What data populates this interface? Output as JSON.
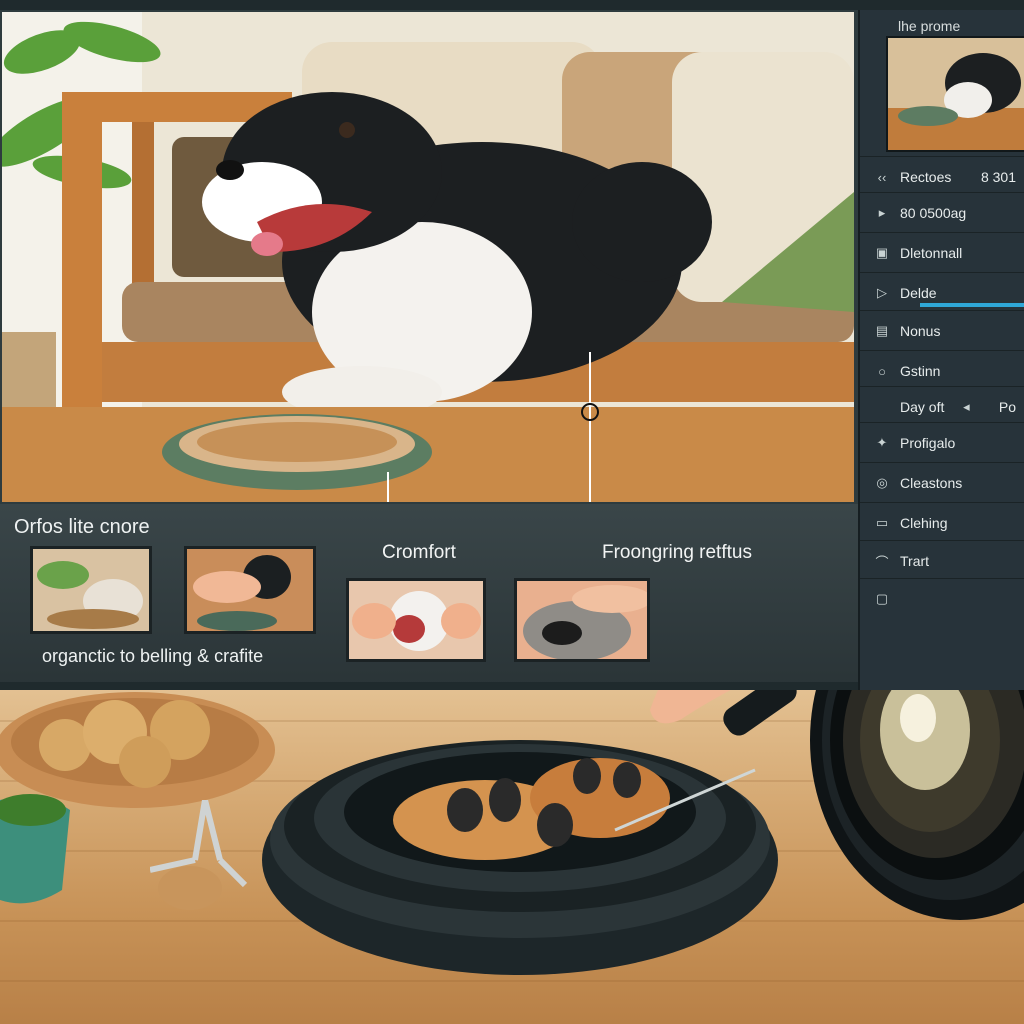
{
  "gallery": {
    "title": "Orfos lite cnore",
    "caption": "organctic to belling & crafite",
    "callouts": [
      "Cromfort",
      "Froongring retftus"
    ]
  },
  "panel": {
    "preview_title": "lhe prome",
    "rows": [
      {
        "icon": "back-icon",
        "label": "Rectoes",
        "value": "8 301"
      },
      {
        "icon": "play-icon",
        "label": "80 0500ag"
      },
      {
        "icon": "square-icon",
        "label": "Dletonnall"
      },
      {
        "icon": "flag-icon",
        "label": "Delde"
      },
      {
        "icon": "layers-icon",
        "label": "Nonus"
      },
      {
        "icon": "circle-icon",
        "label": "Gstinn"
      },
      {
        "icon": "toggle-icon",
        "label": "Day oft",
        "value": "Po"
      },
      {
        "icon": "sparkle-icon",
        "label": "Profigalo"
      },
      {
        "icon": "camera-icon",
        "label": "Cleastons"
      },
      {
        "icon": "image-icon",
        "label": "Clehing"
      },
      {
        "icon": "pen-icon",
        "label": "Trart"
      },
      {
        "icon": "doc-icon",
        "label": ""
      }
    ]
  },
  "colors": {
    "accent": "#2fa8d8",
    "panel_bg": "#27333a",
    "gallery_bg": "#2e3b3e"
  }
}
